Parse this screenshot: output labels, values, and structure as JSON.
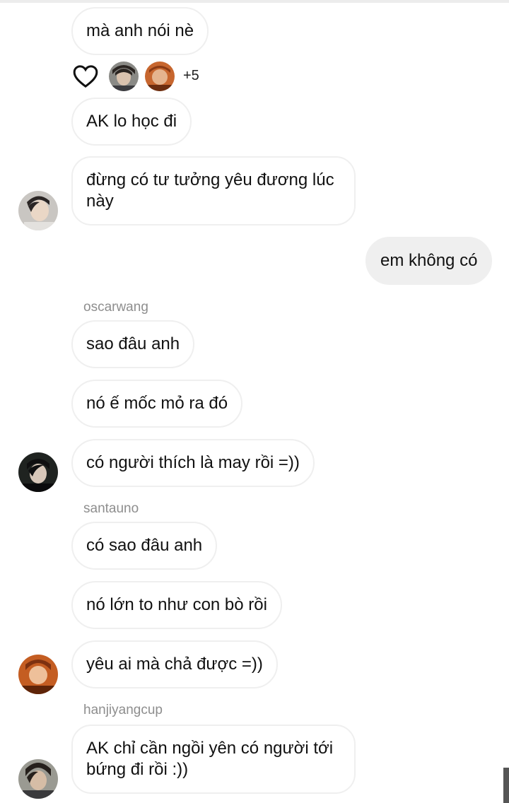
{
  "messages": [
    {
      "text": "mà anh nói nè"
    },
    {
      "text": "AK lo học đi"
    },
    {
      "text": "đừng có tư tưởng yêu đương lúc này"
    },
    {
      "text": "em không có"
    },
    {
      "text": "sao đâu anh"
    },
    {
      "text": "nó ế mốc mỏ ra đó"
    },
    {
      "text": "có người thích là may rồi =))"
    },
    {
      "text": "có sao đâu anh"
    },
    {
      "text": "nó lớn to như con bò rồi"
    },
    {
      "text": "yêu ai mà chả được =))"
    },
    {
      "text": "AK chỉ cần ngồi yên có người tới bứng đi rồi :))"
    }
  ],
  "senders": [
    "oscarwang",
    "santauno",
    "hanjiyangcup"
  ],
  "reactions": {
    "icon": "heart-outline-icon",
    "more_count": "+5"
  },
  "colors": {
    "incoming_bg": "#ffffff",
    "incoming_border": "#efefef",
    "outgoing_bg": "#efefef",
    "meta_text": "#8e8e8e"
  }
}
